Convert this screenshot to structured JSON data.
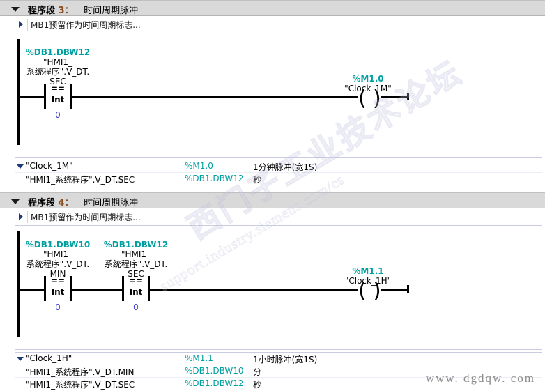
{
  "watermark": {
    "diagonal_cn": "西门子工业技术论坛",
    "diagonal_en": "support.industry.siemens.com/cs",
    "footer": "www. dgdqw. com"
  },
  "colors": {
    "address_teal": "#00a0a0",
    "operand_blue": "#3b3bd0",
    "segment_number": "#8a4b20",
    "header_band": "#d9d9d9"
  },
  "networks": [
    {
      "label": "程序段",
      "number": "3",
      "separator": "：",
      "title": "时间周期脉冲",
      "comment": "MB1预留作为时间周期标志...",
      "contacts": [
        {
          "address": "%DB1.DBW12",
          "symbol_line1": "\"HMI1_",
          "symbol_line2": "系统程序\".V_DT.",
          "symbol_line3": "SEC",
          "operator": "==",
          "datatype": "Int",
          "operand": "0"
        }
      ],
      "coil": {
        "address": "%M1.0",
        "symbol": "\"Clock_1M\""
      },
      "xref": {
        "headers_visible": false,
        "rows": [
          {
            "name": "\"Clock_1M\"",
            "address": "%M1.0",
            "comment": "1分钟脉冲(宽1S)",
            "expander": true
          },
          {
            "name": "\"HMI1_系统程序\".V_DT.SEC",
            "address": "%DB1.DBW12",
            "comment": "秒",
            "expander": false
          }
        ]
      }
    },
    {
      "label": "程序段",
      "number": "4",
      "separator": "：",
      "title": "时间周期脉冲",
      "comment": "MB1预留作为时间周期标志...",
      "contacts": [
        {
          "address": "%DB1.DBW10",
          "symbol_line1": "\"HMI1_",
          "symbol_line2": "系统程序\".V_DT.",
          "symbol_line3": "MIN",
          "operator": "==",
          "datatype": "Int",
          "operand": "0"
        },
        {
          "address": "%DB1.DBW12",
          "symbol_line1": "\"HMI1_",
          "symbol_line2": "系统程序\".V_DT.",
          "symbol_line3": "SEC",
          "operator": "==",
          "datatype": "Int",
          "operand": "0"
        }
      ],
      "coil": {
        "address": "%M1.1",
        "symbol": "\"Clock_1H\""
      },
      "xref": {
        "headers_visible": false,
        "rows": [
          {
            "name": "\"Clock_1H\"",
            "address": "%M1.1",
            "comment": "1小时脉冲(宽1S)",
            "expander": true
          },
          {
            "name": "\"HMI1_系统程序\".V_DT.MIN",
            "address": "%DB1.DBW10",
            "comment": "分",
            "expander": false
          },
          {
            "name": "\"HMI1_系统程序\".V_DT.SEC",
            "address": "%DB1.DBW12",
            "comment": "秒",
            "expander": false
          }
        ]
      }
    }
  ]
}
